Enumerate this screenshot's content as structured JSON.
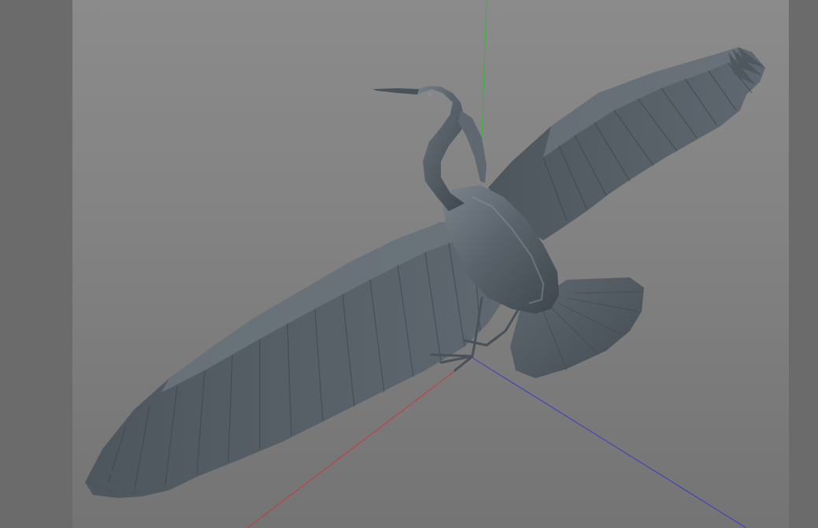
{
  "viewport": {
    "background_color": "#808080",
    "side_panel_color": "#6b6b6b"
  },
  "axes": {
    "x_color": "#c83a3a",
    "y_color": "#3ab43a",
    "z_color": "#3a3ac8"
  },
  "model": {
    "body_color": "#5a636b",
    "shadow_color": "#454c53",
    "highlight_color": "#8a939b"
  }
}
